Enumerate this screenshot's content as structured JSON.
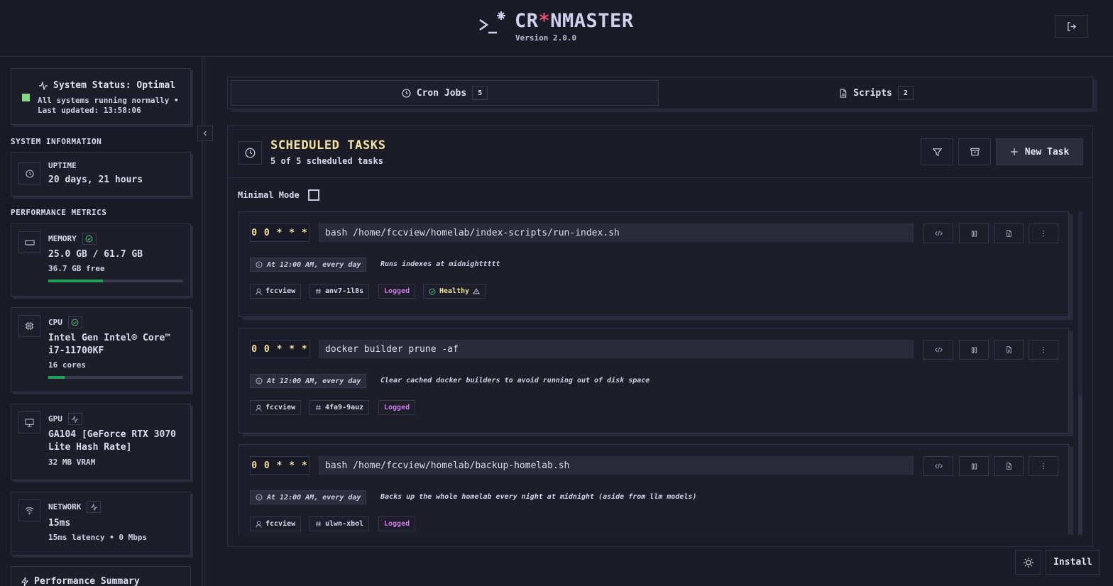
{
  "header": {
    "title_pre": "CR",
    "title_star": "*",
    "title_post": "NMASTER",
    "version": "Version 2.0.0"
  },
  "status": {
    "title": "System Status: Optimal",
    "line1": "All systems running normally •",
    "line2": "Last updated: 13:58:06",
    "color": "#7ddc7d"
  },
  "system_info": {
    "label": "SYSTEM INFORMATION",
    "uptime_label": "UPTIME",
    "uptime_value": "20 days, 21 hours"
  },
  "performance": {
    "label": "PERFORMANCE METRICS",
    "memory": {
      "label": "MEMORY",
      "value": "25.0 GB / 61.7 GB",
      "sub": "36.7 GB free",
      "usage_fraction": 0.405
    },
    "cpu": {
      "label": "CPU",
      "value": "Intel Gen Intel® Core™ i7-11700KF",
      "sub": "16 cores",
      "usage_fraction": 0.12
    },
    "gpu": {
      "label": "GPU",
      "value": "GA104 [GeForce RTX 3070 Lite Hash Rate]",
      "sub": "32 MB VRAM"
    },
    "network": {
      "label": "NETWORK",
      "value": "15ms",
      "sub": "15ms latency • 0 Mbps"
    },
    "summary_label": "Performance Summary"
  },
  "tabs": [
    {
      "label": "Cron Jobs",
      "count": "5"
    },
    {
      "label": "Scripts",
      "count": "2"
    }
  ],
  "panel": {
    "title": "SCHEDULED TASKS",
    "subtitle": "5 of 5 scheduled tasks",
    "new_task_label": "New Task",
    "minimal_mode_label": "Minimal Mode"
  },
  "jobs": [
    {
      "schedule": "0 0 * * *",
      "command": "bash /home/fccview/homelab/index-scripts/run-index.sh",
      "when": "At 12:00 AM, every day",
      "description": "Runs indexes at midnighttttt",
      "user": "fccview",
      "id": "anv7-1l8s",
      "logged": "Logged",
      "health": "Healthy"
    },
    {
      "schedule": "0 0 * * *",
      "command": "docker builder prune -af",
      "when": "At 12:00 AM, every day",
      "description": "Clear cached docker builders to avoid running out of disk space",
      "user": "fccview",
      "id": "4fa9-9auz",
      "logged": "Logged"
    },
    {
      "schedule": "0 0 * * *",
      "command": "bash /home/fccview/homelab/backup-homelab.sh",
      "when": "At 12:00 AM, every day",
      "description": "Backs up the whole homelab every night at midnight (aside from llm models)",
      "user": "fccview",
      "id": "ulwn-xbol",
      "logged": "Logged"
    }
  ],
  "footer": {
    "install_label": "Install"
  },
  "colors": {
    "accent_yellow": "#f2e29b",
    "logged_purple": "#c77de6",
    "progress_green": "#23a055",
    "logo_star_red": "#e0506e"
  }
}
